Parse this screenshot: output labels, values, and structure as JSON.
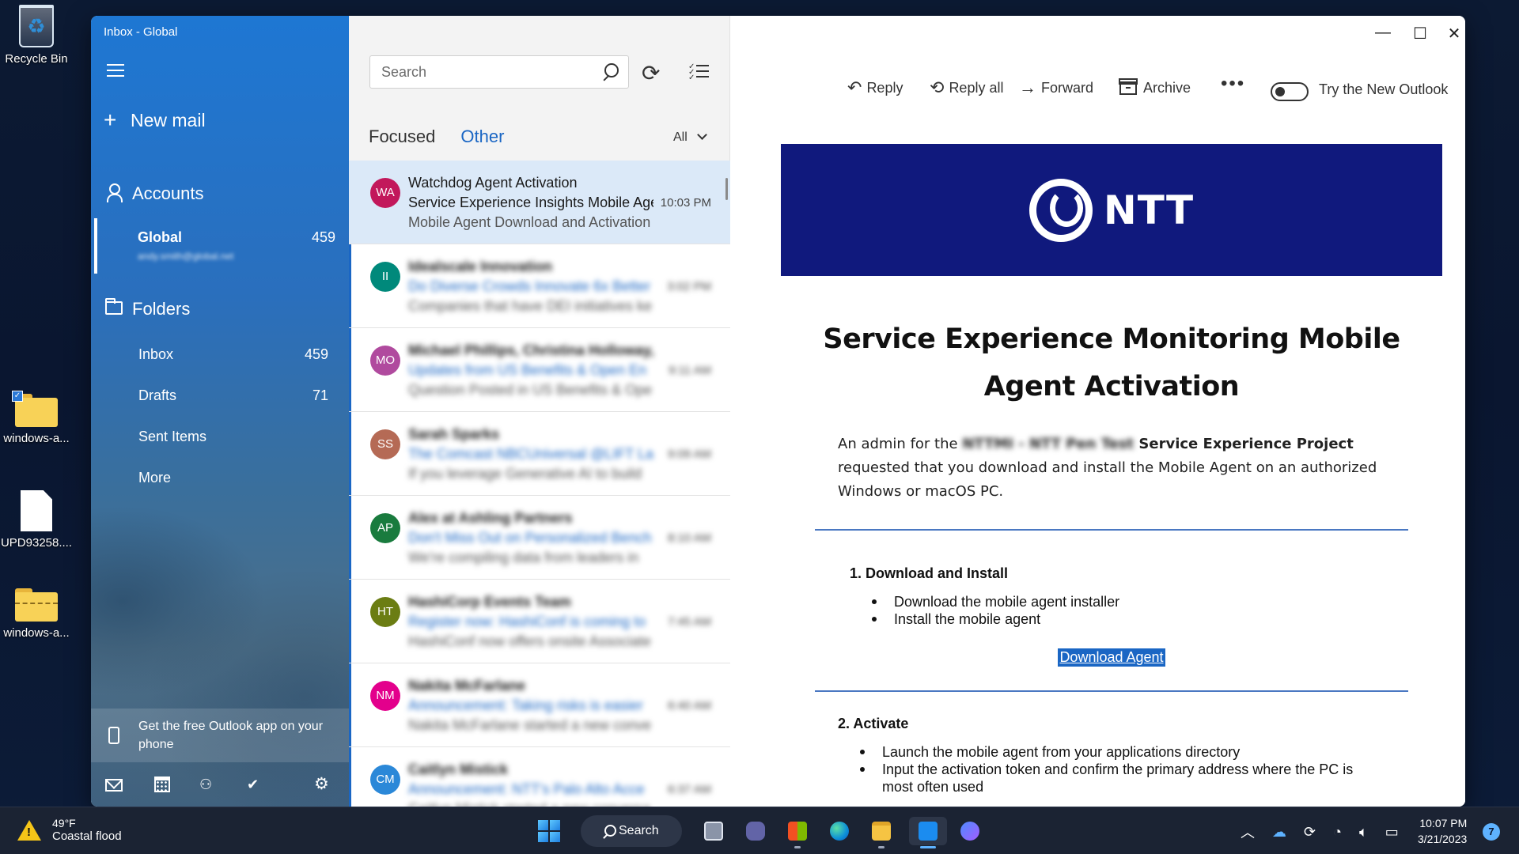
{
  "desktop": {
    "icons": [
      {
        "label": "Recycle Bin"
      },
      {
        "label": "windows-a..."
      },
      {
        "label": "UPD93258...."
      },
      {
        "label": "windows-a..."
      }
    ]
  },
  "window": {
    "title": "Inbox - Global",
    "caption": {
      "minimize": "—",
      "maximize": "☐",
      "close": "✕"
    }
  },
  "nav": {
    "new_mail": "New mail",
    "accounts_label": "Accounts",
    "account": {
      "name": "Global",
      "count": "459",
      "email": "andy.smith@global.net"
    },
    "folders_label": "Folders",
    "folders": [
      {
        "label": "Inbox",
        "count": "459"
      },
      {
        "label": "Drafts",
        "count": "71"
      },
      {
        "label": "Sent Items",
        "count": ""
      },
      {
        "label": "More",
        "count": ""
      }
    ],
    "promo": "Get the free Outlook app on your phone",
    "icons": [
      "mail-icon",
      "calendar-icon",
      "people-icon",
      "todo-icon",
      "settings-icon"
    ]
  },
  "list": {
    "search_placeholder": "Search",
    "tabs": [
      "Focused",
      "Other"
    ],
    "active_tab": "Other",
    "filter": "All",
    "messages": [
      {
        "initials": "WA",
        "color": "#c2185b",
        "sender": "Watchdog Agent Activation",
        "subject": "Service Experience Insights Mobile Agent",
        "preview": "Mobile Agent Download and Activation",
        "time": "10:03 PM",
        "selected": true,
        "blurred": false
      },
      {
        "initials": "II",
        "color": "#00897b",
        "sender": "Idealscale Innovation",
        "subject": "Do Diverse Crowds Innovate 6x Better",
        "preview": "Companies that have DEI initiatives ke",
        "time": "3:02 PM",
        "selected": false,
        "blurred": true
      },
      {
        "initials": "MO",
        "color": "#b04a9e",
        "sender": "Michael Phillips, Christina Holloway,",
        "subject": "Updates from US Benefits & Open En",
        "preview": "Question Posted in US Benefits & Ope",
        "time": "9:11 AM",
        "selected": false,
        "blurred": true
      },
      {
        "initials": "SS",
        "color": "#b56a55",
        "sender": "Sarah Sparks",
        "subject": "The Comcast NBCUniversal @LIFT La",
        "preview": "If you leverage Generative AI to build",
        "time": "9:09 AM",
        "selected": false,
        "blurred": true
      },
      {
        "initials": "AP",
        "color": "#197b3e",
        "sender": "Alex at Ashling Partners",
        "subject": "Don't Miss Out on Personalized Bench",
        "preview": "We're compiling data from leaders in",
        "time": "8:10 AM",
        "selected": false,
        "blurred": true
      },
      {
        "initials": "HT",
        "color": "#6b7d13",
        "sender": "HashiCorp Events Team",
        "subject": "Register now: HashiConf is coming to",
        "preview": "HashiConf now offers onsite Associate",
        "time": "7:45 AM",
        "selected": false,
        "blurred": true
      },
      {
        "initials": "NM",
        "color": "#e3008c",
        "sender": "Nakita McFarlane",
        "subject": "Announcement: Taking risks is easier",
        "preview": "Nakita McFarlane started a new conve",
        "time": "6:40 AM",
        "selected": false,
        "blurred": true
      },
      {
        "initials": "CM",
        "color": "#2b88d8",
        "sender": "Caitlyn Mistick",
        "subject": "Announcement: NTT's Palo Alto Acce",
        "preview": "Caitlyn Mistick started a new conversa",
        "time": "6:37 AM",
        "selected": false,
        "blurred": true
      }
    ]
  },
  "reading": {
    "toolbar": {
      "reply": "Reply",
      "reply_all": "Reply all",
      "forward": "Forward",
      "archive": "Archive",
      "more": "•••",
      "toggle_label": "Try the New Outlook"
    },
    "banner_logo": "NTT",
    "headline": "Service Experience Monitoring Mobile Agent Activation",
    "intro_pre": "An admin for the ",
    "intro_redacted": "NTTMI - NTT Pen Test",
    "intro_bold": " Service Experience Project",
    "intro_post": " requested that you download and install the Mobile Agent on an authorized Windows or macOS PC.",
    "step1_title": "1. Download and Install",
    "step1_items": [
      "Download the mobile agent installer",
      "Install the mobile agent"
    ],
    "download_link": "Download Agent",
    "step2_title": "2. Activate",
    "step2_items": [
      "Launch the mobile agent from your applications directory",
      "Input the activation token and confirm the primary address where the PC is most often used"
    ]
  },
  "taskbar": {
    "weather_temp": "49°F",
    "weather_desc": "Coastal flood",
    "search": "Search",
    "time": "10:07 PM",
    "date": "3/21/2023",
    "notifications": "7",
    "accent": "#1a66c4"
  }
}
